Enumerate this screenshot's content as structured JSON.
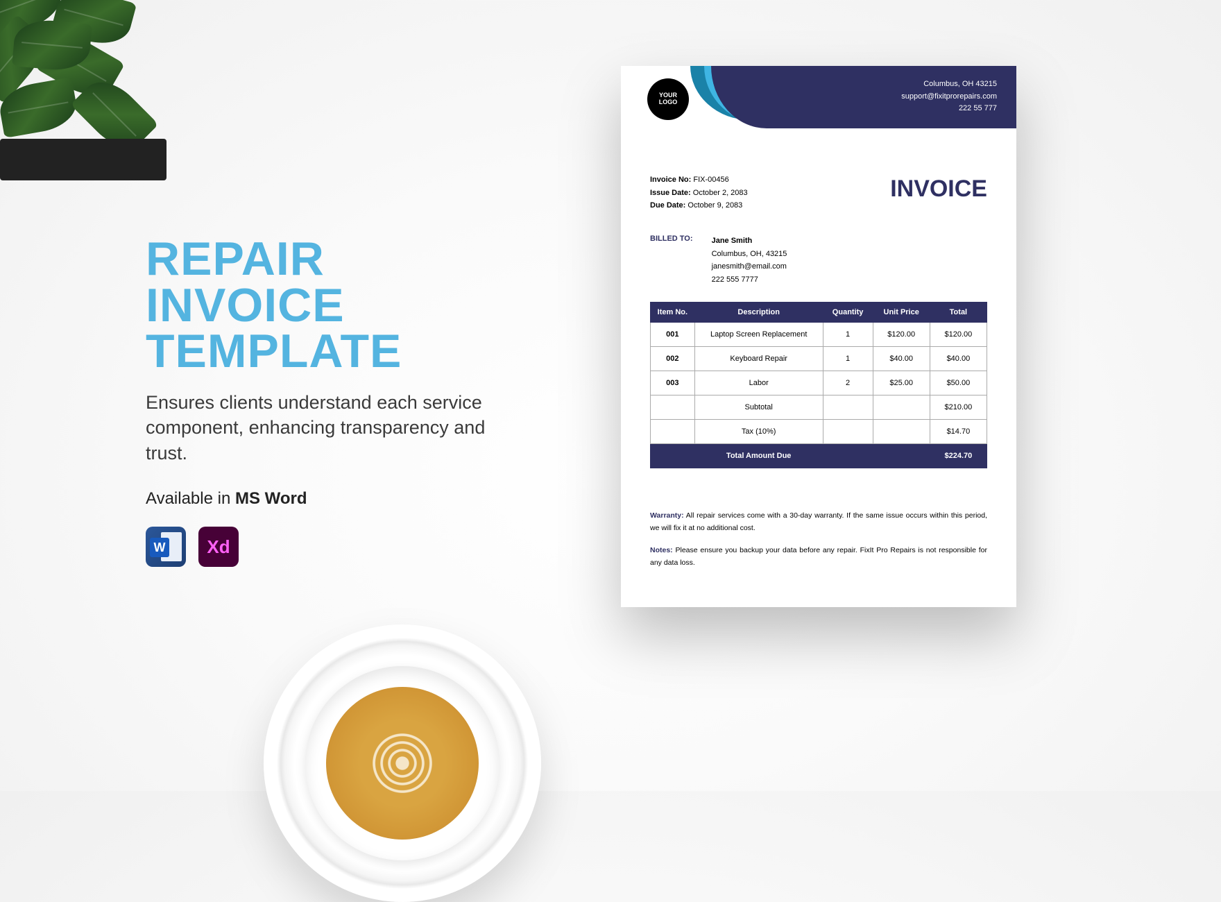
{
  "promo": {
    "title_l1": "REPAIR",
    "title_l2": "INVOICE",
    "title_l3": "TEMPLATE",
    "subtitle": "Ensures clients understand each service component, enhancing transparency and trust.",
    "available_prefix": "Available in ",
    "available_app": "MS Word",
    "word_letter": "W",
    "xd_letter": "Xd"
  },
  "logo": {
    "line1": "YOUR",
    "line2": "LOGO"
  },
  "company": {
    "city": "Columbus, OH 43215",
    "email": "support@fixitprorepairs.com",
    "phone": "222 55 777"
  },
  "invoice": {
    "no_label": "Invoice No:",
    "no": "FIX-00456",
    "issue_label": "Issue Date:",
    "issue": "October 2, 2083",
    "due_label": "Due Date:",
    "due": "October 9, 2083",
    "title": "INVOICE"
  },
  "billed": {
    "label": "BILLED TO:",
    "name": "Jane Smith",
    "addr": "Columbus, OH, 43215",
    "email": "janesmith@email.com",
    "phone": "222 555 7777"
  },
  "cols": {
    "no": "Item No.",
    "desc": "Description",
    "qty": "Quantity",
    "price": "Unit Price",
    "total": "Total"
  },
  "rows": [
    {
      "no": "001",
      "desc": "Laptop Screen Replacement",
      "qty": "1",
      "price": "$120.00",
      "total": "$120.00"
    },
    {
      "no": "002",
      "desc": "Keyboard Repair",
      "qty": "1",
      "price": "$40.00",
      "total": "$40.00"
    },
    {
      "no": "003",
      "desc": "Labor",
      "qty": "2",
      "price": "$25.00",
      "total": "$50.00"
    }
  ],
  "summary": {
    "subtotal_label": "Subtotal",
    "subtotal": "$210.00",
    "tax_label": "Tax (10%)",
    "tax": "$14.70",
    "total_label": "Total Amount Due",
    "total": "$224.70"
  },
  "warranty": {
    "k": "Warranty:",
    "v": "All repair services come with a 30-day warranty. If the same issue occurs within this period, we will fix it at no additional cost."
  },
  "notes": {
    "k": "Notes:",
    "v": "Please ensure you backup your data before any repair. FixIt Pro Repairs is not responsible for any data loss."
  }
}
